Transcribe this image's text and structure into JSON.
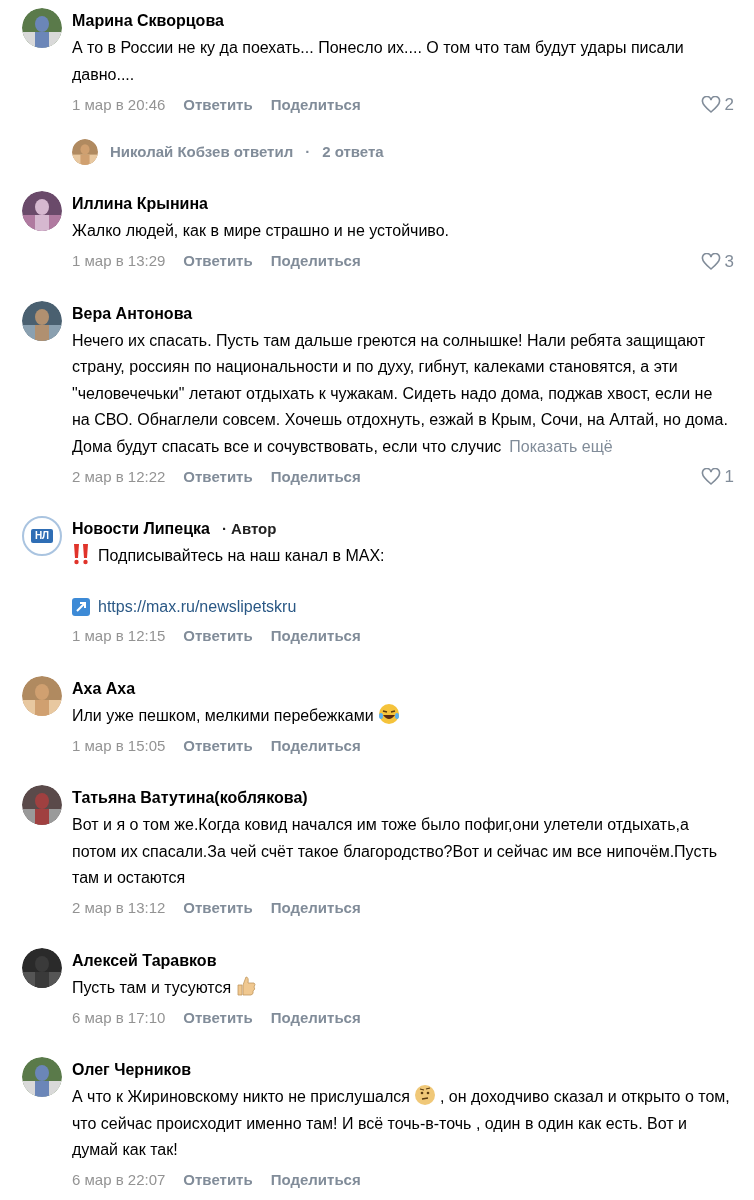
{
  "comments": [
    {
      "author": "Марина Скворцова",
      "avatar": {
        "kind": "picture"
      },
      "body": [
        {
          "kind": "text",
          "text": "А то в России не ку да поехать... Понесло их.... О том что там будут удары писали давно...."
        }
      ],
      "date": "1 мар в 20:46",
      "reply": "Ответить",
      "share": "Поделиться",
      "likes": "2",
      "replies": {
        "text": "Николай Кобзев ответил",
        "separator": "·",
        "count": "2 ответа"
      }
    },
    {
      "author": "Иллина Крынина",
      "avatar": {
        "kind": "picture"
      },
      "body": [
        {
          "kind": "text",
          "text": "Жалко людей, как в мире страшно и не устойчиво."
        }
      ],
      "date": "1 мар в 13:29",
      "reply": "Ответить",
      "share": "Поделиться",
      "likes": "3"
    },
    {
      "author": "Вера Антонова",
      "avatar": {
        "kind": "picture"
      },
      "body": [
        {
          "kind": "text",
          "text": "Нечего их спасать. Пусть там дальше греются на солнышке! Нали ребята защищают страну, россиян по национальности и по духу, гибнут, калеками становятся, а эти \"человечечьки\" летают отдыхать к чужакам. Сидеть надо дома, поджав хвост, если не на СВО. Обнаглели совсем. Хочешь отдохнуть, езжай в Крым, Сочи, на Алтай, но дома. Дома будут спасать все и сочувствовать, если что случис"
        }
      ],
      "more": "Показать ещё",
      "date": "2 мар в 12:22",
      "reply": "Ответить",
      "share": "Поделиться",
      "likes": "1"
    },
    {
      "author": "Новости Липецка",
      "avatar": {
        "kind": "logo",
        "text": "НЛ"
      },
      "badge": "· Автор",
      "body": [
        {
          "kind": "alert"
        },
        {
          "kind": "text",
          "text": "Подписывайтесь на наш канал в MAX:"
        }
      ],
      "link": "https://max.ru/newslipetskru",
      "date": "1 мар в 12:15",
      "reply": "Ответить",
      "share": "Поделиться"
    },
    {
      "author": "Аха Аха",
      "avatar": {
        "kind": "picture"
      },
      "body": [
        {
          "kind": "text",
          "text": "Или уже пешком, мелкими перебежками"
        },
        {
          "kind": "laughing"
        }
      ],
      "date": "1 мар в 15:05",
      "reply": "Ответить",
      "share": "Поделиться"
    },
    {
      "author": "Татьяна Ватутина(коблякова)",
      "avatar": {
        "kind": "picture"
      },
      "body": [
        {
          "kind": "text",
          "text": "Вот и я о том же.Когда ковид начался им тоже было пофиг,они улетели отдыхать,а потом их спасали.За чей счёт такое благородство?Вот и сейчас им все нипочём.Пусть там и остаются"
        }
      ],
      "date": "2 мар в 13:12",
      "reply": "Ответить",
      "share": "Поделиться"
    },
    {
      "author": "Алексей Таравков",
      "avatar": {
        "kind": "picture"
      },
      "body": [
        {
          "kind": "text",
          "text": "Пусть там и тусуются"
        },
        {
          "kind": "thumbs_up"
        }
      ],
      "date": "6 мар в 17:10",
      "reply": "Ответить",
      "share": "Поделиться"
    },
    {
      "author": "Олег Черников",
      "avatar": {
        "kind": "picture"
      },
      "body": [
        {
          "kind": "text",
          "text": "А что к Жириновскому никто не прислушался"
        },
        {
          "kind": "thinking"
        },
        {
          "kind": "text",
          "text": ", он доходчиво сказал и открыто о том, что сейчас происходит именно там! И всё точь-в-точь , один в один как есть. Вот и думай как так!"
        }
      ],
      "date": "6 мар в 22:07",
      "reply": "Ответить",
      "share": "Поделиться"
    }
  ]
}
